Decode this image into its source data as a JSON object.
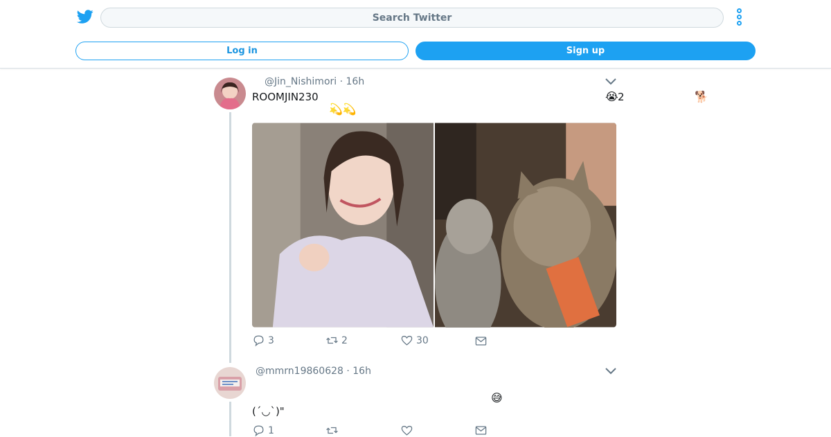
{
  "header": {
    "search_placeholder": "Search Twitter",
    "login_label": "Log in",
    "signup_label": "Sign up",
    "logo_icon": "twitter-bird-icon",
    "more_icon": "vertical-dots-icon",
    "accent_color": "#1da1f2"
  },
  "tweets": [
    {
      "meta": "@Jin_Nishimori · 16h",
      "text": "ROOMJIN230",
      "emoji_shooting_stars": "💫💫",
      "emoji_crying": "😭",
      "emoji_count": "2",
      "emoji_dog": "🐕",
      "media": [
        "selfie-photo",
        "cat-photo"
      ],
      "replies": "3",
      "retweets": "2",
      "likes": "30"
    },
    {
      "meta": "@mmrn19860628 · 16h",
      "text": "(ˊ◡ˋ)\"",
      "emoji_sweat": "😅",
      "replies": "1",
      "retweets": "",
      "likes": ""
    }
  ]
}
